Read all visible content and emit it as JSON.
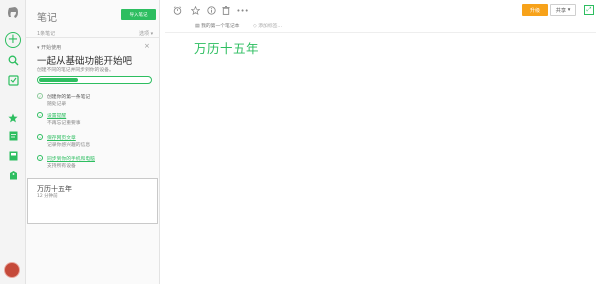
{
  "rail": {
    "logo_icon": "elephant-logo-icon",
    "new_icon": "plus-icon",
    "search_icon": "search-icon",
    "workchat_icon": "chat-icon",
    "shortcuts_icon": "star-icon",
    "notes_icon": "note-icon",
    "notebooks_icon": "notebook-icon",
    "tags_icon": "tag-icon",
    "avatar_icon": "avatar"
  },
  "note_list": {
    "title": "笔记",
    "import_button": "导入笔记",
    "count": "1条笔记",
    "sort_label": "选项 ▾",
    "getting_started": {
      "header": "开始使用",
      "title": "一起从基础功能开始吧",
      "subtitle": "创建不同的笔记并同步到你的设备。",
      "progress_fraction": 0.35,
      "tasks": [
        {
          "title": "创建你的第一条笔记",
          "detail": "随处记录",
          "state": "done"
        },
        {
          "title": "设置提醒",
          "detail": "不再忘记重要事",
          "state": "todo"
        },
        {
          "title": "保存网页文章",
          "detail": "记录你感兴趣的信息",
          "state": "todo"
        },
        {
          "title": "同步到你的手机和电脑",
          "detail": "支持所有设备",
          "state": "todo"
        }
      ]
    },
    "notes": [
      {
        "title": "万历十五年",
        "meta": "12 分钟前"
      }
    ]
  },
  "editor": {
    "toolbar": {
      "reminder_icon": "alarm-clock-icon",
      "shortcut_icon": "star-icon",
      "info_icon": "info-icon",
      "delete_icon": "trash-icon",
      "more_icon": "more-icon",
      "upgrade_button": "升级",
      "share_button": "共享",
      "expand_icon": "expand-icon"
    },
    "notebook": "我的第一个笔记本",
    "tag_placeholder": "添加标签...",
    "note_title": "万历十五年"
  },
  "colors": {
    "accent_green": "#2dbe60",
    "upgrade_orange": "#f7a21a"
  }
}
